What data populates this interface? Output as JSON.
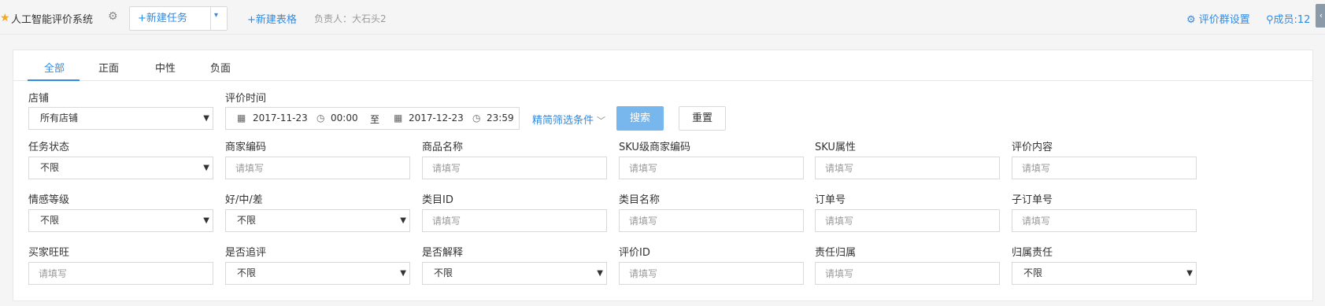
{
  "header": {
    "app_title": "人工智能评价系统",
    "new_task_label": "+新建任务",
    "new_table_label": "+新建表格",
    "owner_text": "负责人：大石头2",
    "settings_label": "评价群设置",
    "members_label": "成员:12",
    "edge_icon": "‹"
  },
  "tabs": [
    {
      "label": "全部"
    },
    {
      "label": "正面"
    },
    {
      "label": "中性"
    },
    {
      "label": "负面"
    }
  ],
  "filters": {
    "shop": {
      "label": "店铺",
      "value": "所有店铺"
    },
    "eval_time": {
      "label": "评价时间",
      "start_date": "2017-11-23",
      "start_time": "00:00",
      "separator": "至",
      "end_date": "2017-12-23",
      "end_time": "23:59"
    },
    "refine_label": "精简筛选条件",
    "search_label": "搜索",
    "reset_label": "重置",
    "task_status": {
      "label": "任务状态",
      "value": "不限"
    },
    "merchant_code": {
      "label": "商家编码",
      "placeholder": "请填写"
    },
    "product_name": {
      "label": "商品名称",
      "placeholder": "请填写"
    },
    "sku_merchant_code": {
      "label": "SKU级商家编码",
      "placeholder": "请填写"
    },
    "sku_attr": {
      "label": "SKU属性",
      "placeholder": "请填写"
    },
    "eval_content": {
      "label": "评价内容",
      "placeholder": "请填写"
    },
    "emotion_level": {
      "label": "情感等级",
      "value": "不限"
    },
    "rating": {
      "label": "好/中/差",
      "value": "不限"
    },
    "category_id": {
      "label": "类目ID",
      "placeholder": "请填写"
    },
    "category_name": {
      "label": "类目名称",
      "placeholder": "请填写"
    },
    "order_no": {
      "label": "订单号",
      "placeholder": "请填写"
    },
    "sub_order_no": {
      "label": "子订单号",
      "placeholder": "请填写"
    },
    "buyer_wangwang": {
      "label": "买家旺旺",
      "placeholder": "请填写"
    },
    "followup": {
      "label": "是否追评",
      "value": "不限"
    },
    "explained": {
      "label": "是否解释",
      "value": "不限"
    },
    "eval_id": {
      "label": "评价ID",
      "placeholder": "请填写"
    },
    "responsibility": {
      "label": "责任归属",
      "placeholder": "请填写"
    },
    "assigned_responsibility": {
      "label": "归属责任",
      "value": "不限"
    }
  },
  "colors": {
    "accent": "#2f8be3",
    "search_button": "#78b7ed",
    "star": "#f5a623"
  }
}
